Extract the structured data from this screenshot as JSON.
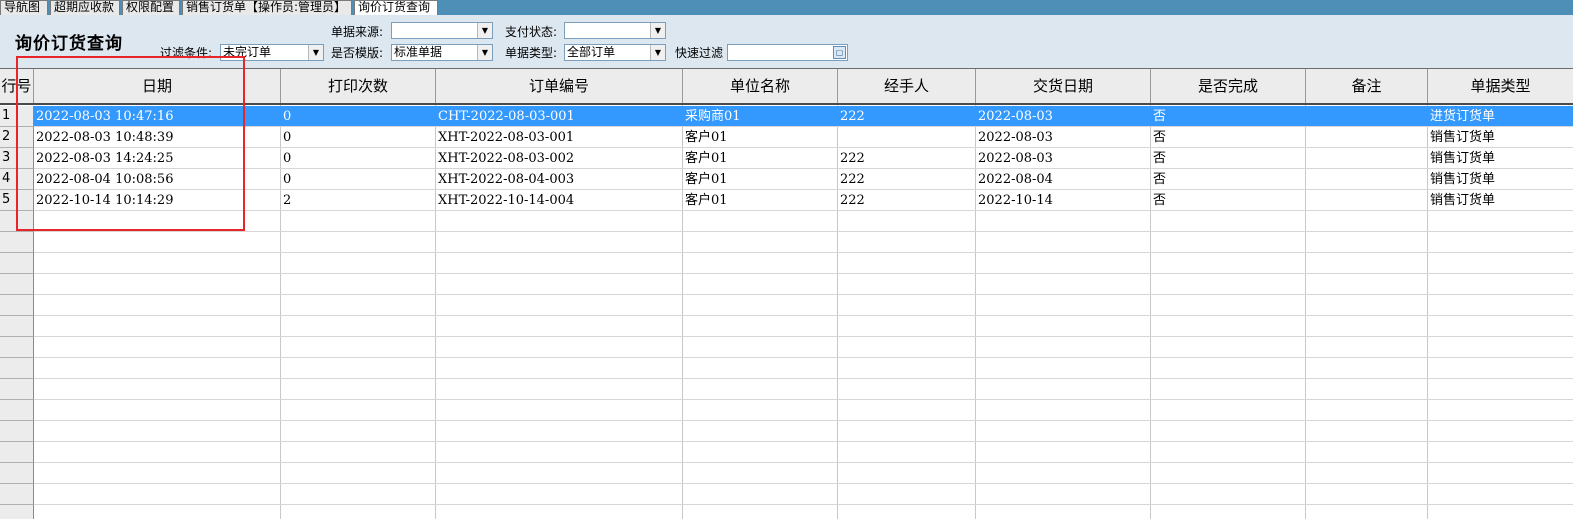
{
  "tabs": [
    {
      "label": "导航图",
      "active": false
    },
    {
      "label": "超期应收款",
      "active": false
    },
    {
      "label": "权限配置",
      "active": false
    },
    {
      "label": "销售订货单【操作员:管理员】",
      "active": false
    },
    {
      "label": "询价订货查询",
      "active": true
    }
  ],
  "page_title": "询价订货查询",
  "filters": {
    "condition_label": "过滤条件:",
    "condition_value": "未完订单",
    "source_label": "单据来源:",
    "source_value": "",
    "template_label": "是否模版:",
    "template_value": "标准单据",
    "pay_status_label": "支付状态:",
    "pay_status_value": "",
    "doc_type_label": "单据类型:",
    "doc_type_value": "全部订单",
    "quick_filter_label": "快速过滤",
    "quick_filter_value": ""
  },
  "grid": {
    "columns": [
      "行号",
      "日期",
      "打印次数",
      "订单编号",
      "单位名称",
      "经手人",
      "交货日期",
      "是否完成",
      "备注",
      "单据类型"
    ],
    "rows": [
      {
        "no": "1",
        "date": "2022-08-03 10:47:16",
        "print": "0",
        "order": "CHT-2022-08-03-001",
        "unit": "采购商01",
        "handler": "222",
        "delivery": "2022-08-03",
        "done": "否",
        "note": "",
        "type": "进货订货单",
        "selected": true
      },
      {
        "no": "2",
        "date": "2022-08-03 10:48:39",
        "print": "0",
        "order": "XHT-2022-08-03-001",
        "unit": "客户01",
        "handler": "",
        "delivery": "2022-08-03",
        "done": "否",
        "note": "",
        "type": "销售订货单",
        "selected": false
      },
      {
        "no": "3",
        "date": "2022-08-03 14:24:25",
        "print": "0",
        "order": "XHT-2022-08-03-002",
        "unit": "客户01",
        "handler": "222",
        "delivery": "2022-08-03",
        "done": "否",
        "note": "",
        "type": "销售订货单",
        "selected": false
      },
      {
        "no": "4",
        "date": "2022-08-04 10:08:56",
        "print": "0",
        "order": "XHT-2022-08-04-003",
        "unit": "客户01",
        "handler": "222",
        "delivery": "2022-08-04",
        "done": "否",
        "note": "",
        "type": "销售订货单",
        "selected": false
      },
      {
        "no": "5",
        "date": "2022-10-14 10:14:29",
        "print": "2",
        "order": "XHT-2022-10-14-004",
        "unit": "客户01",
        "handler": "222",
        "delivery": "2022-10-14",
        "done": "否",
        "note": "",
        "type": "销售订货单",
        "selected": false
      }
    ],
    "empty_rows": 15
  },
  "colors": {
    "tab_strip": "#4e8fb8",
    "toolbar_bg": "#dde7f0",
    "selection": "#3399ff",
    "annotation": "#e8262a"
  },
  "icons": {
    "dropdown": "chevron-down-icon",
    "quick_filter_button": "filter-search-icon"
  }
}
